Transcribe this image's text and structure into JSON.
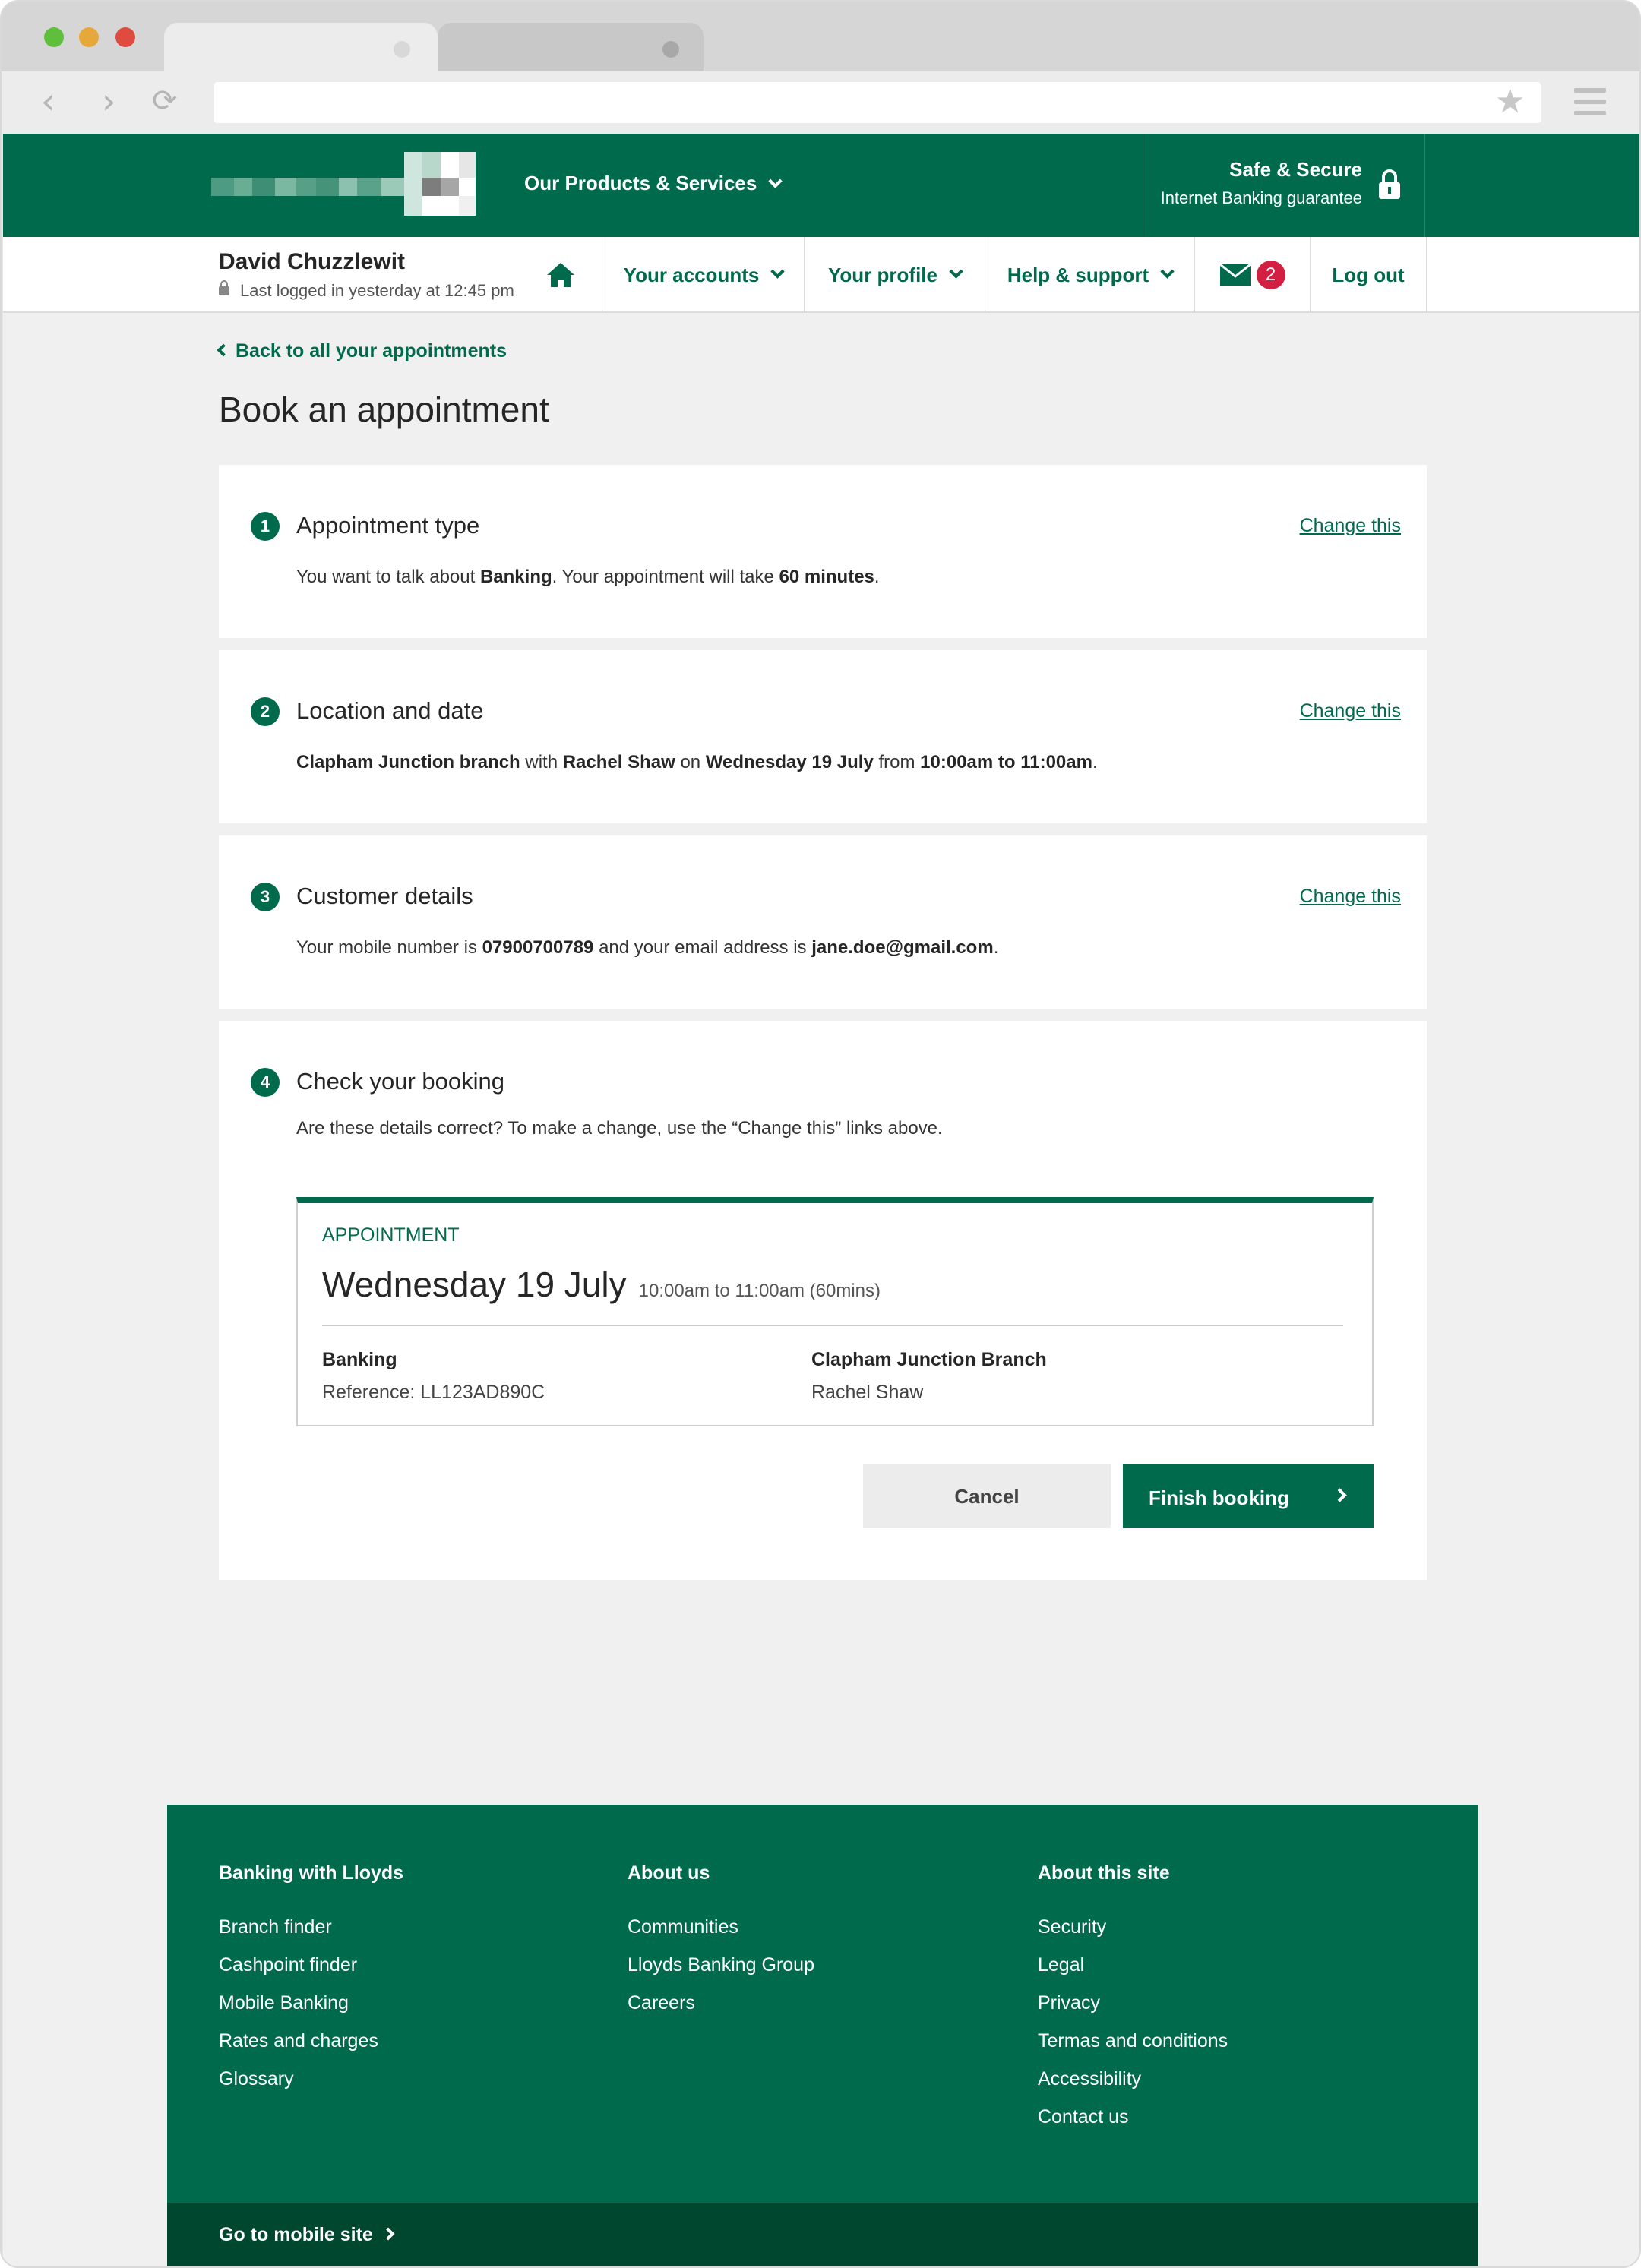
{
  "header": {
    "products_label": "Our Products & Services",
    "safe_title": "Safe & Secure",
    "safe_subtitle": "Internet Banking guarantee"
  },
  "user": {
    "name": "David Chuzzlewit",
    "last_login": "Last logged in yesterday at 12:45 pm"
  },
  "nav": {
    "accounts": "Your accounts",
    "profile": "Your profile",
    "help": "Help & support",
    "messages_count": "2",
    "logout": "Log out"
  },
  "page": {
    "back_link": "Back to all your appointments",
    "title": "Book an appointment"
  },
  "steps": [
    {
      "number": "1",
      "title": "Appointment type",
      "change_label": "Change this",
      "desc_parts": [
        "You want to talk about ",
        "Banking",
        ". Your appointment will take ",
        "60 minutes",
        "."
      ]
    },
    {
      "number": "2",
      "title": "Location and date",
      "change_label": "Change this",
      "desc_parts": [
        "Clapham Junction branch",
        " with ",
        "Rachel Shaw",
        " on ",
        "Wednesday 19 July",
        " from ",
        "10:00am to 11:00am",
        "."
      ]
    },
    {
      "number": "3",
      "title": "Customer details",
      "change_label": "Change this",
      "desc_parts": [
        "Your mobile number is ",
        "07900700789",
        " and your email address is ",
        "jane.doe@gmail.com",
        "."
      ]
    },
    {
      "number": "4",
      "title": "Check your booking",
      "desc": "Are these details correct? To make a change, use the “Change this” links above."
    }
  ],
  "summary": {
    "label": "APPOINTMENT",
    "date": "Wednesday 19 July",
    "time": "10:00am to 11:00am (60mins)",
    "topic": "Banking",
    "reference": "Reference:  LL123AD890C",
    "branch": "Clapham Junction Branch",
    "advisor": "Rachel Shaw"
  },
  "actions": {
    "cancel": "Cancel",
    "finish": "Finish booking"
  },
  "footer": {
    "col1": {
      "heading": "Banking with Lloyds",
      "links": [
        "Branch finder",
        "Cashpoint finder",
        "Mobile Banking",
        "Rates and charges",
        "Glossary"
      ]
    },
    "col2": {
      "heading": "About us",
      "links": [
        "Communities",
        "Lloyds Banking Group",
        "Careers"
      ]
    },
    "col3": {
      "heading": "About this site",
      "links": [
        "Security",
        "Legal",
        "Privacy",
        "Termas and conditions",
        "Accessibility",
        "Contact us"
      ]
    },
    "mobile_site": "Go to mobile site"
  },
  "colors": {
    "brand_green": "#006a4d",
    "dark_green": "#00472f",
    "badge_red": "#d31f41"
  }
}
